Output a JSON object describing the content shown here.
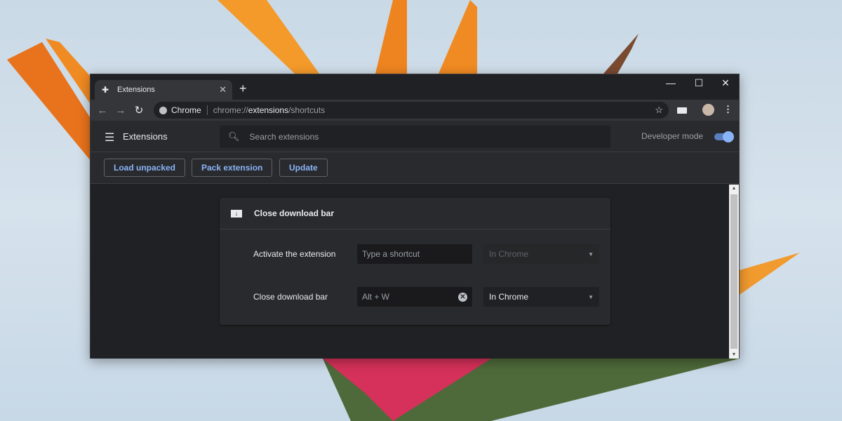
{
  "tab": {
    "title": "Extensions",
    "close": "✕",
    "new_tab": "+"
  },
  "window_controls": {
    "minimize": "—",
    "maximize": "☐",
    "close": "✕"
  },
  "toolbar": {
    "back": "←",
    "forward": "→",
    "reload": "↻",
    "site_chip": "Chrome",
    "url_prefix": "chrome://",
    "url_bold": "extensions",
    "url_suffix": "/shortcuts",
    "star": "☆",
    "menu": "⋮"
  },
  "header": {
    "title": "Extensions",
    "search_placeholder": "Search extensions",
    "developer_mode_label": "Developer mode",
    "developer_mode": true
  },
  "buttons": {
    "load_unpacked": "Load unpacked",
    "pack_extension": "Pack extension",
    "update": "Update"
  },
  "card": {
    "title": "Close download bar",
    "rows": [
      {
        "label": "Activate the extension",
        "shortcut_value": "",
        "shortcut_placeholder": "Type a shortcut",
        "scope": "In Chrome",
        "scope_disabled": true
      },
      {
        "label": "Close download bar",
        "shortcut_value": "Alt + W",
        "scope": "In Chrome",
        "scope_disabled": false
      }
    ]
  },
  "colors": {
    "accent": "#8ab4f8",
    "background": "#202124",
    "surface": "#292a2d"
  }
}
